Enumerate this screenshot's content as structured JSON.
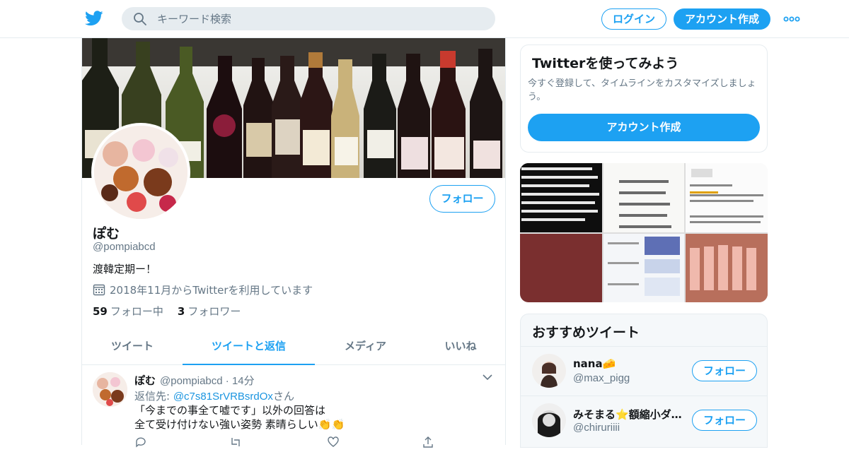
{
  "header": {
    "search_placeholder": "キーワード検索",
    "login_label": "ログイン",
    "signup_label": "アカウント作成"
  },
  "profile": {
    "name": "ぽむ",
    "handle": "@pompiabcd",
    "bio": "渡韓定期ー！",
    "joined": "2018年11月からTwitterを利用しています",
    "following_count": "59",
    "following_label": "フォロー中",
    "followers_count": "3",
    "followers_label": "フォロワー",
    "follow_label": "フォロー"
  },
  "tabs": [
    {
      "label": "ツイート",
      "active": false
    },
    {
      "label": "ツイートと返信",
      "active": true
    },
    {
      "label": "メディア",
      "active": false
    },
    {
      "label": "いいね",
      "active": false
    }
  ],
  "tweet": {
    "name": "ぽむ",
    "handle": "@pompiabcd",
    "time": "14分",
    "reply_prefix": "返信先: ",
    "reply_to": "@c7s81SrVRBsrdOx",
    "reply_suffix": "さん",
    "text": "「今までの事全て嘘です」以外の回答は\n全て受け付けない強い姿勢 素晴らしい👏👏"
  },
  "signup_card": {
    "title": "Twitterを使ってみよう",
    "desc": "今すぐ登録して、タイムラインをカスタマイズしましょう。",
    "button": "アカウント作成"
  },
  "recommendations": {
    "title": "おすすめツイート",
    "items": [
      {
        "name": "nana🧀",
        "handle": "@max_pigg",
        "button": "フォロー"
      },
      {
        "name": "みそまる⭐️額縮小ダ…",
        "handle": "@chiruriiii",
        "button": "フォロー"
      }
    ]
  },
  "colors": {
    "accent": "#1da1f2",
    "muted": "#657786",
    "border": "#e6ecf0"
  }
}
